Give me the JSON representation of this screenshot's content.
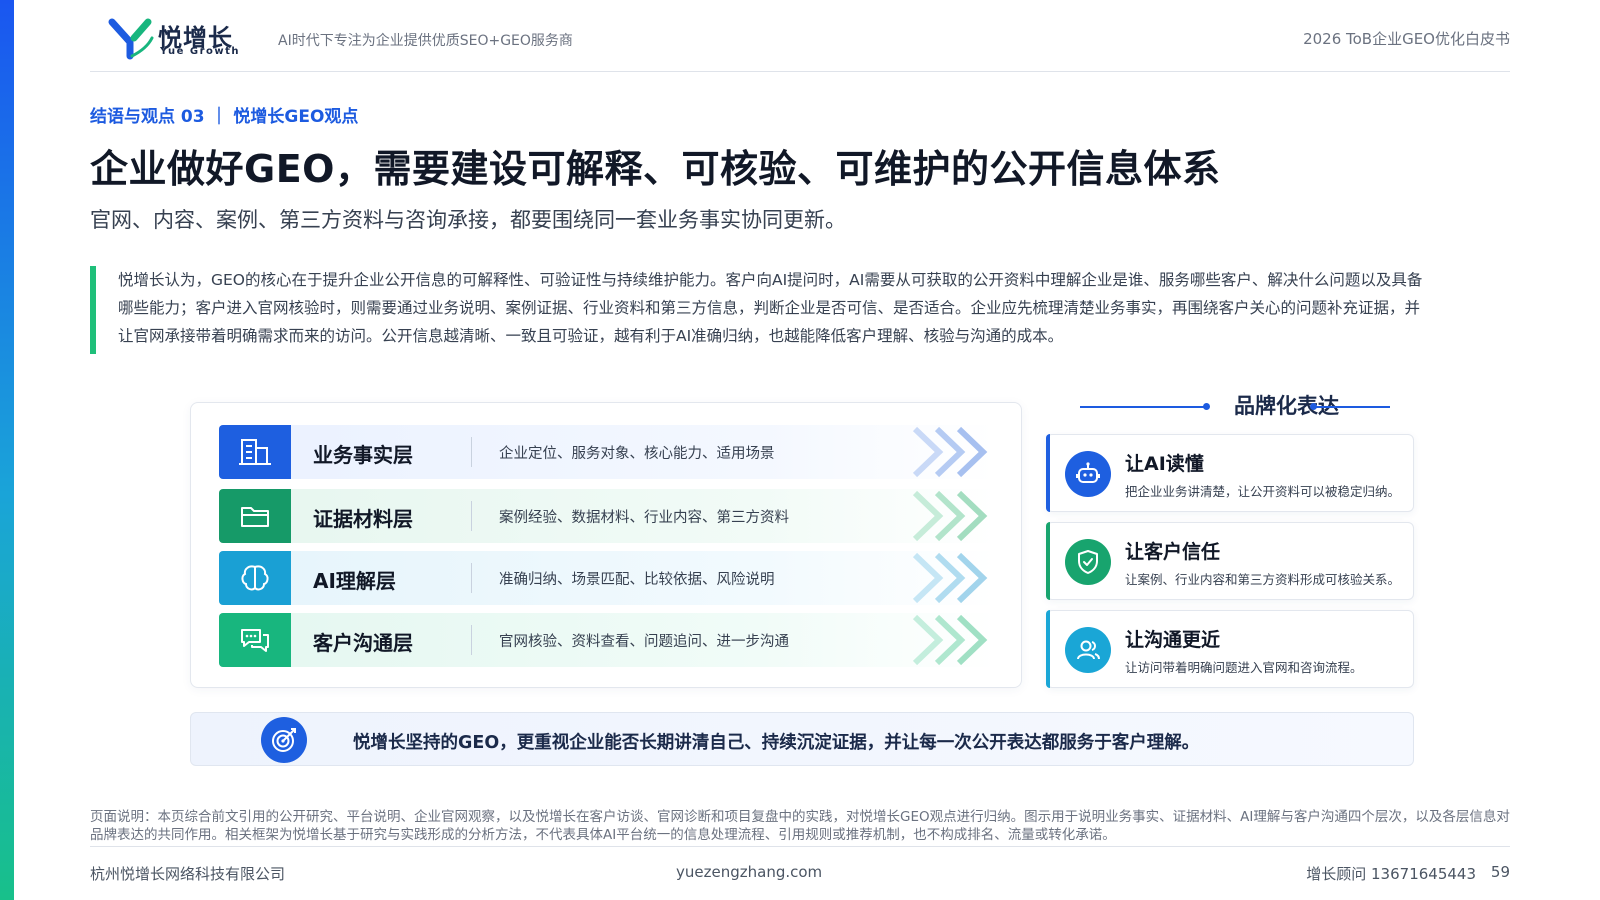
{
  "header": {
    "logo_name": "悦增长",
    "logo_sub": "Yue Growth",
    "tagline": "AI时代下专注为企业提供优质SEO+GEO服务商",
    "doc_title": "2026 ToB企业GEO优化白皮书"
  },
  "section_label": "结语与观点 03 ｜ 悦增长GEO观点",
  "title": "企业做好GEO，需要建设可解释、可核验、可维护的公开信息体系",
  "subtitle": "官网、内容、案例、第三方资料与咨询承接，都要围绕同一套业务事实协同更新。",
  "quote": "悦增长认为，GEO的核心在于提升企业公开信息的可解释性、可验证性与持续维护能力。客户向AI提问时，AI需要从可获取的公开资料中理解企业是谁、服务哪些客户、解决什么问题以及具备哪些能力；客户进入官网核验时，则需要通过业务说明、案例证据、行业资料和第三方信息，判断企业是否可信、是否适合。企业应先梳理清楚业务事实，再围绕客户关心的问题补充证据，并让官网承接带着明确需求而来的访问。公开信息越清晰、一致且可验证，越有利于AI准确归纳，也越能降低客户理解、核验与沟通的成本。",
  "layers": [
    {
      "icon": "building-icon",
      "name": "业务事实层",
      "desc": "企业定位、服务对象、核心能力、适用场景",
      "color": "#1e5fe0"
    },
    {
      "icon": "folder-icon",
      "name": "证据材料层",
      "desc": "案例经验、数据材料、行业内容、第三方资料",
      "color": "#169a68"
    },
    {
      "icon": "brain-icon",
      "name": "AI理解层",
      "desc": "准确归纳、场景匹配、比较依据、风险说明",
      "color": "#1aa0d4"
    },
    {
      "icon": "chat-icon",
      "name": "客户沟通层",
      "desc": "官网核验、资料查看、问题追问、进一步沟通",
      "color": "#18b67e"
    }
  ],
  "brand": {
    "heading": "品牌化表达",
    "cards": [
      {
        "icon": "robot-icon",
        "title": "让AI读懂",
        "desc": "把企业业务讲清楚，让公开资料可以被稳定归纳。"
      },
      {
        "icon": "shield-check-icon",
        "title": "让客户信任",
        "desc": "让案例、行业内容和第三方资料形成可核验关系。"
      },
      {
        "icon": "users-icon",
        "title": "让沟通更近",
        "desc": "让访问带着明确问题进入官网和咨询流程。"
      }
    ]
  },
  "statement": {
    "icon": "target-icon",
    "text": "悦增长坚持的GEO，更重视企业能否长期讲清自己、持续沉淀证据，并让每一次公开表达都服务于客户理解。"
  },
  "note": "页面说明：本页综合前文引用的公开研究、平台说明、企业官网观察，以及悦增长在客户访谈、官网诊断和项目复盘中的实践，对悦增长GEO观点进行归纳。图示用于说明业务事实、证据材料、AI理解与客户沟通四个层次，以及各层信息对品牌表达的共同作用。相关框架为悦增长基于研究与实践形成的分析方法，不代表具体AI平台统一的信息处理流程、引用规则或推荐机制，也不构成排名、流量或转化承诺。",
  "footer": {
    "company": "杭州悦增长网络科技有限公司",
    "site": "yuezengzhang.com",
    "contact": "增长顾问 13671645443",
    "page": "59"
  },
  "colors": {
    "brand_blue": "#1d5be0",
    "green": "#18a46e",
    "cyan": "#1aa6d6"
  }
}
